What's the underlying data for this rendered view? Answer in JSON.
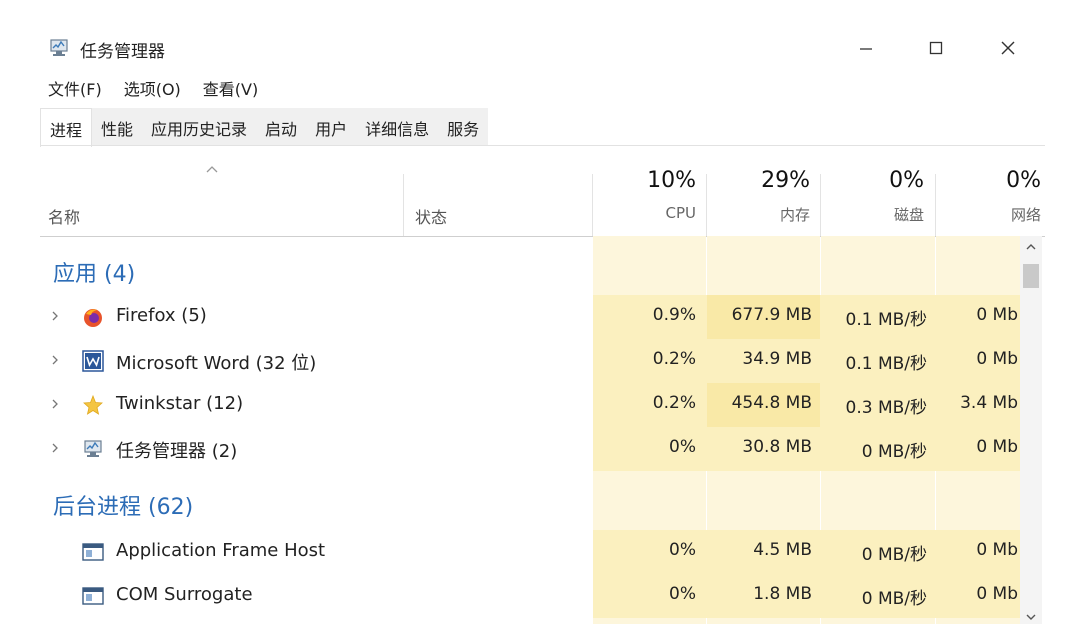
{
  "window": {
    "title": "任务管理器"
  },
  "menu": [
    "文件(F)",
    "选项(O)",
    "查看(V)"
  ],
  "tabs": [
    "进程",
    "性能",
    "应用历史记录",
    "启动",
    "用户",
    "详细信息",
    "服务"
  ],
  "columns": {
    "name": "名称",
    "status": "状态",
    "cpu": {
      "pct": "10%",
      "label": "CPU"
    },
    "mem": {
      "pct": "29%",
      "label": "内存"
    },
    "disk": {
      "pct": "0%",
      "label": "磁盘"
    },
    "net": {
      "pct": "0%",
      "label": "网络"
    }
  },
  "groups": {
    "apps": "应用 (4)",
    "background": "后台进程 (62)"
  },
  "apps": [
    {
      "name": "Firefox (5)",
      "icon": "firefox-icon",
      "cpu": "0.9%",
      "mem": "677.9 MB",
      "disk": "0.1 MB/秒",
      "net": "0 Mb"
    },
    {
      "name": "Microsoft Word (32 位)",
      "icon": "word-icon",
      "cpu": "0.2%",
      "mem": "34.9 MB",
      "disk": "0.1 MB/秒",
      "net": "0 Mb"
    },
    {
      "name": "Twinkstar (12)",
      "icon": "twinkstar-icon",
      "cpu": "0.2%",
      "mem": "454.8 MB",
      "disk": "0.3 MB/秒",
      "net": "3.4 Mb"
    },
    {
      "name": "任务管理器 (2)",
      "icon": "task-manager-icon",
      "cpu": "0%",
      "mem": "30.8 MB",
      "disk": "0 MB/秒",
      "net": "0 Mb"
    }
  ],
  "background": [
    {
      "name": "Application Frame Host",
      "icon": "app-window-icon",
      "cpu": "0%",
      "mem": "4.5 MB",
      "disk": "0 MB/秒",
      "net": "0 Mb"
    },
    {
      "name": "COM Surrogate",
      "icon": "app-window-icon",
      "cpu": "0%",
      "mem": "1.8 MB",
      "disk": "0 MB/秒",
      "net": "0 Mb"
    }
  ],
  "colors": {
    "heat_light": "#fdf6dc",
    "heat_medium": "#fbf0bf",
    "heat_strong": "#f9e9a7",
    "group_text": "#2c6cb6"
  }
}
